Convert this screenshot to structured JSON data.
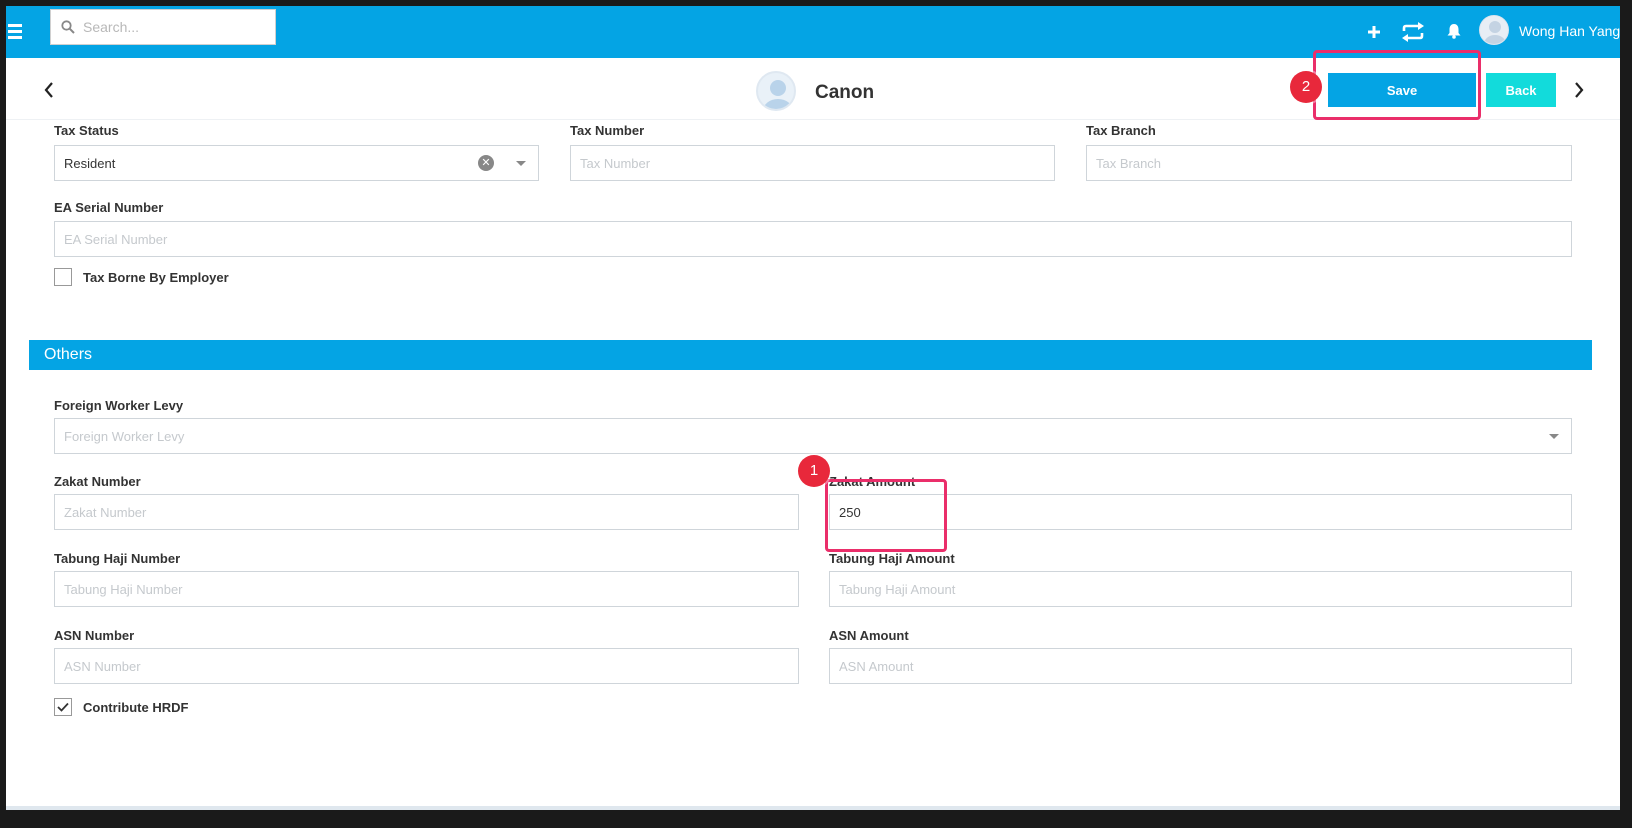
{
  "topbar": {
    "search_placeholder": "Search...",
    "icons": [
      "plus-icon",
      "sync-icon",
      "bell-icon"
    ],
    "user_name": "Wong Han Yang"
  },
  "header": {
    "profile_name": "Canon",
    "save_label": "Save",
    "back_label": "Back"
  },
  "tax": {
    "tax_status_label": "Tax Status",
    "tax_status_value": "Resident",
    "tax_number_label": "Tax Number",
    "tax_number_placeholder": "Tax Number",
    "tax_branch_label": "Tax Branch",
    "tax_branch_placeholder": "Tax Branch",
    "ea_serial_label": "EA Serial Number",
    "ea_serial_placeholder": "EA Serial Number",
    "tax_borne_label": "Tax Borne By Employer",
    "tax_borne_checked": false
  },
  "others": {
    "section_title": "Others",
    "fwl_label": "Foreign Worker Levy",
    "fwl_placeholder": "Foreign Worker Levy",
    "zakat_number_label": "Zakat Number",
    "zakat_number_placeholder": "Zakat Number",
    "zakat_amount_label": "Zakat Amount",
    "zakat_amount_value": "250",
    "tabung_haji_number_label": "Tabung Haji Number",
    "tabung_haji_number_placeholder": "Tabung Haji Number",
    "tabung_haji_amount_label": "Tabung Haji Amount",
    "tabung_haji_amount_placeholder": "Tabung Haji Amount",
    "asn_number_label": "ASN Number",
    "asn_number_placeholder": "ASN Number",
    "asn_amount_label": "ASN Amount",
    "asn_amount_placeholder": "ASN Amount",
    "hrdf_label": "Contribute HRDF",
    "hrdf_checked": true
  },
  "annotations": {
    "step1": "1",
    "step2": "2",
    "highlight_color": "#ea2e6a"
  },
  "colors": {
    "primary": "#04a4e4",
    "back_button": "#12dbdb",
    "badge": "#e8283b"
  }
}
